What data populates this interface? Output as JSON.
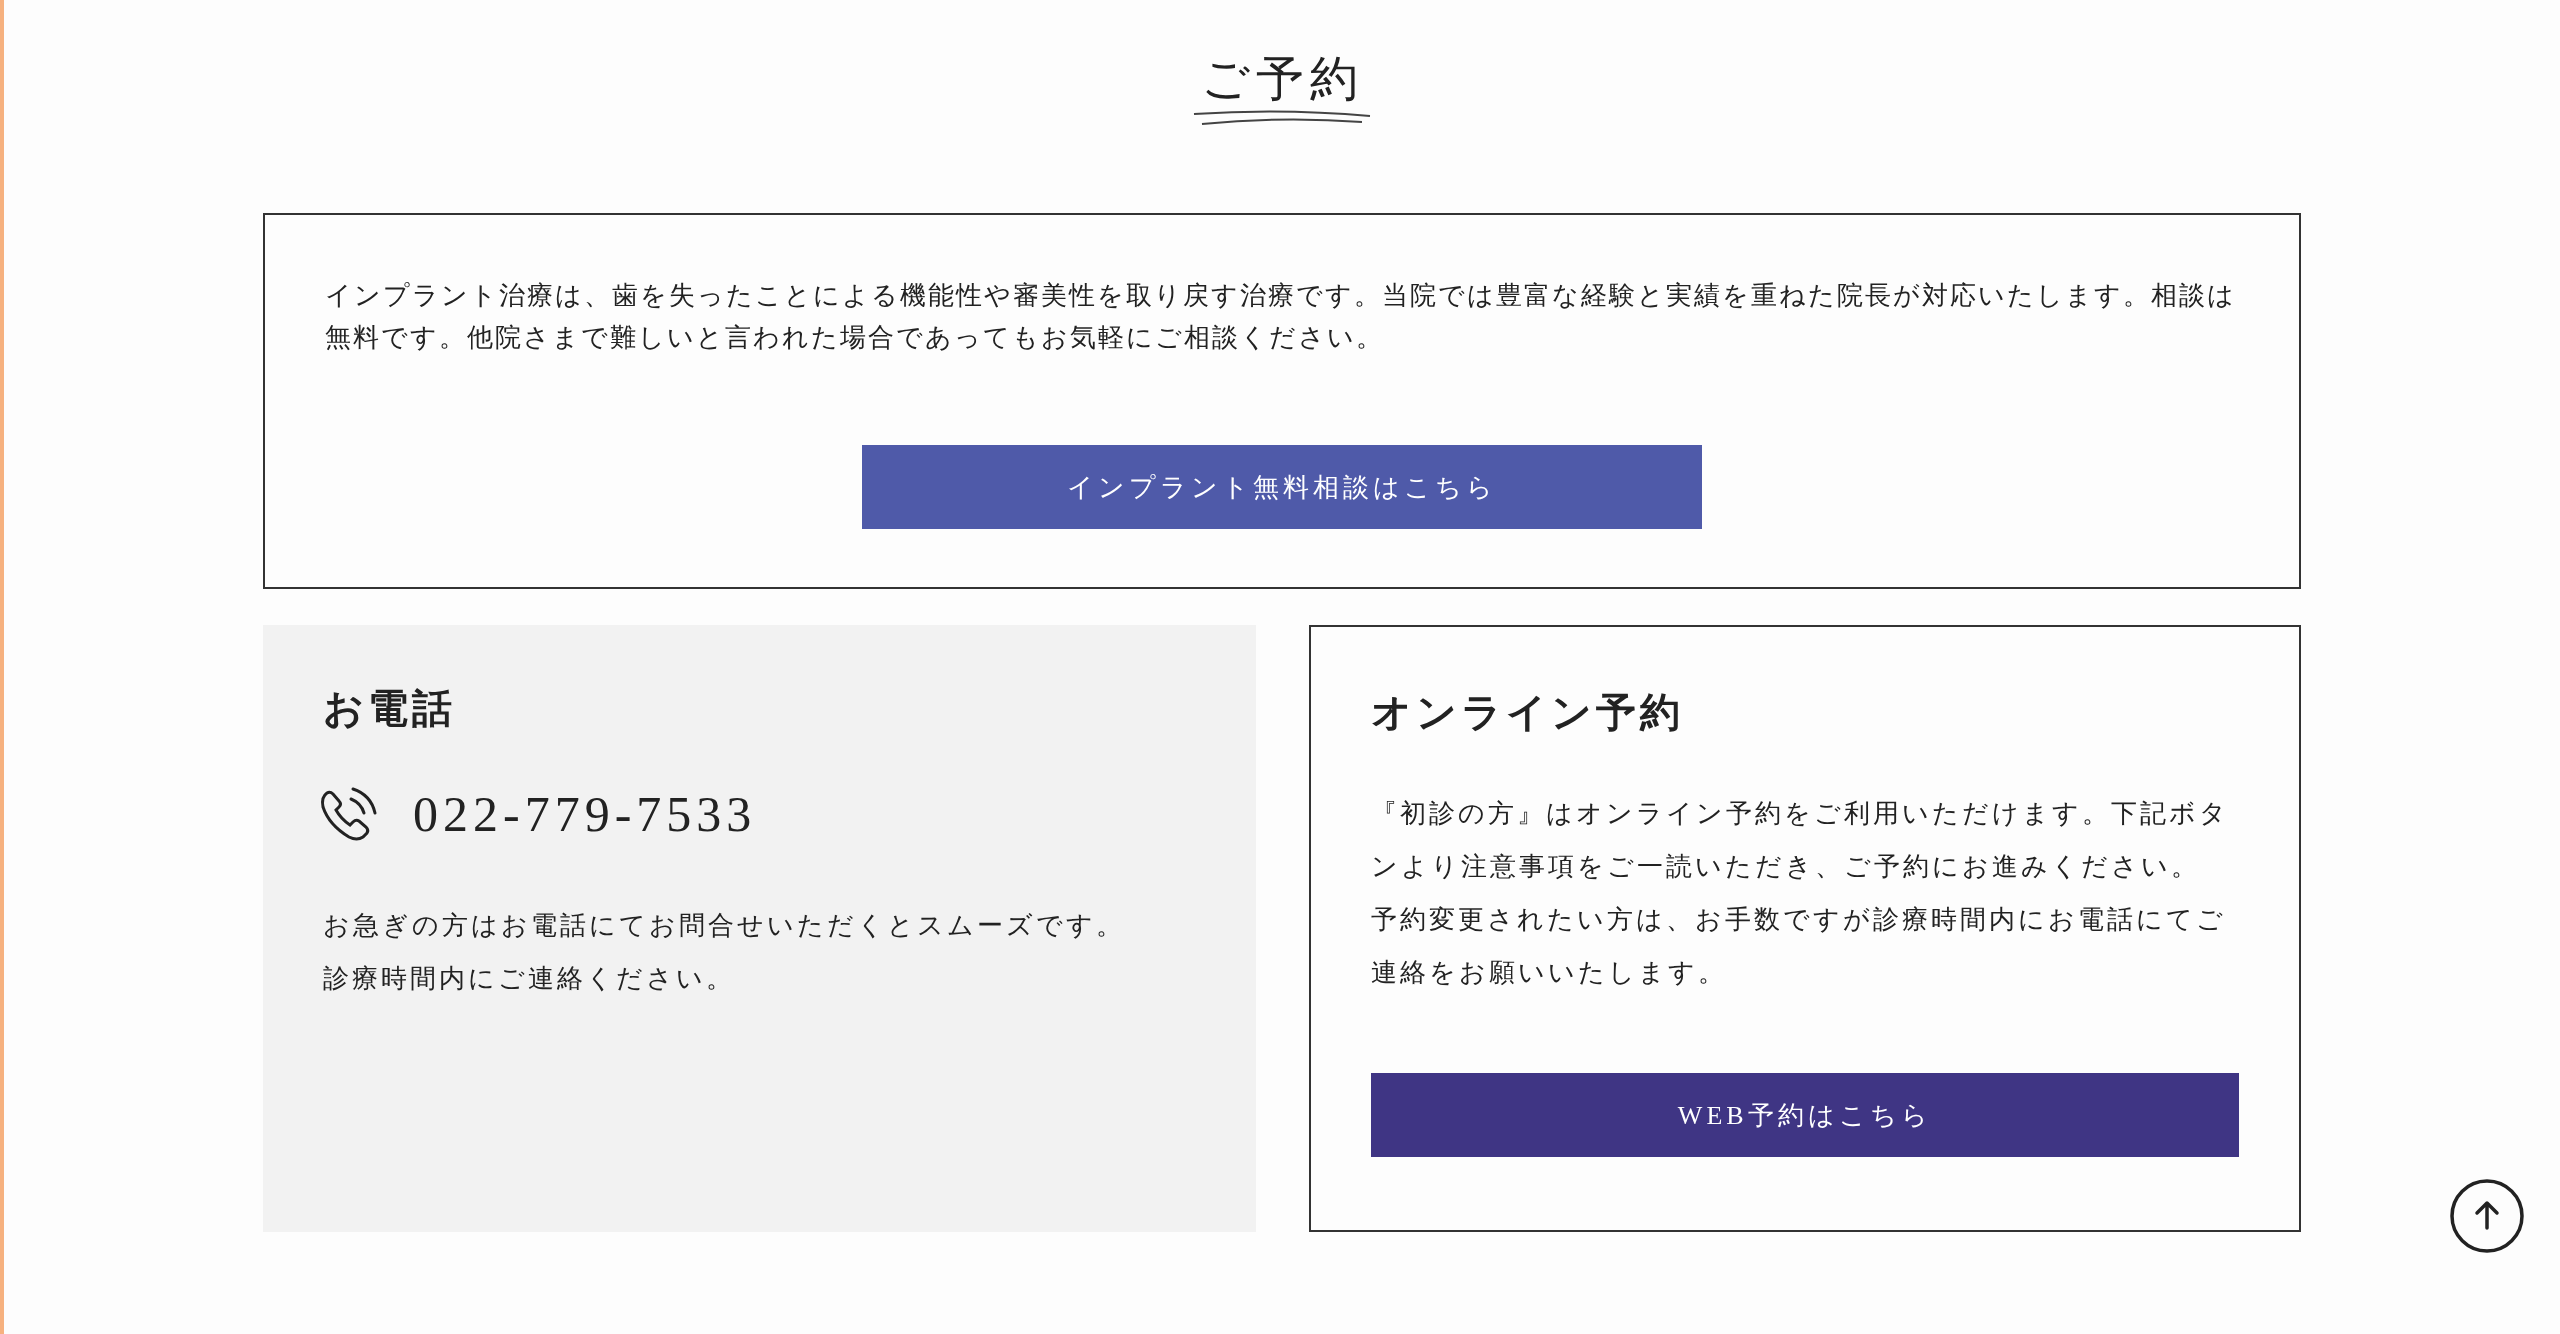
{
  "title": "ご予約",
  "intro": {
    "text": "インプラント治療は、歯を失ったことによる機能性や審美性を取り戻す治療です。当院では豊富な経験と実績を重ねた院長が対応いたします。相談は無料です。他院さまで難しいと言われた場合であってもお気軽にご相談ください。",
    "button": "インプラント無料相談はこちら"
  },
  "phone": {
    "heading": "お電話",
    "number": "022-779-7533",
    "lines": [
      "お急ぎの方はお電話にてお問合せいただくとスムーズです。",
      "診療時間内にご連絡ください。"
    ]
  },
  "online": {
    "heading": "オンライン予約",
    "paragraphs": [
      "『初診の方』はオンライン予約をご利用いただけます。下記ボタンより注意事項をご一読いただき、ご予約にお進みください。",
      "予約変更されたい方は、お手数ですが診療時間内にお電話にてご連絡をお願いいたします。"
    ],
    "button": "WEB予約はこちら"
  }
}
